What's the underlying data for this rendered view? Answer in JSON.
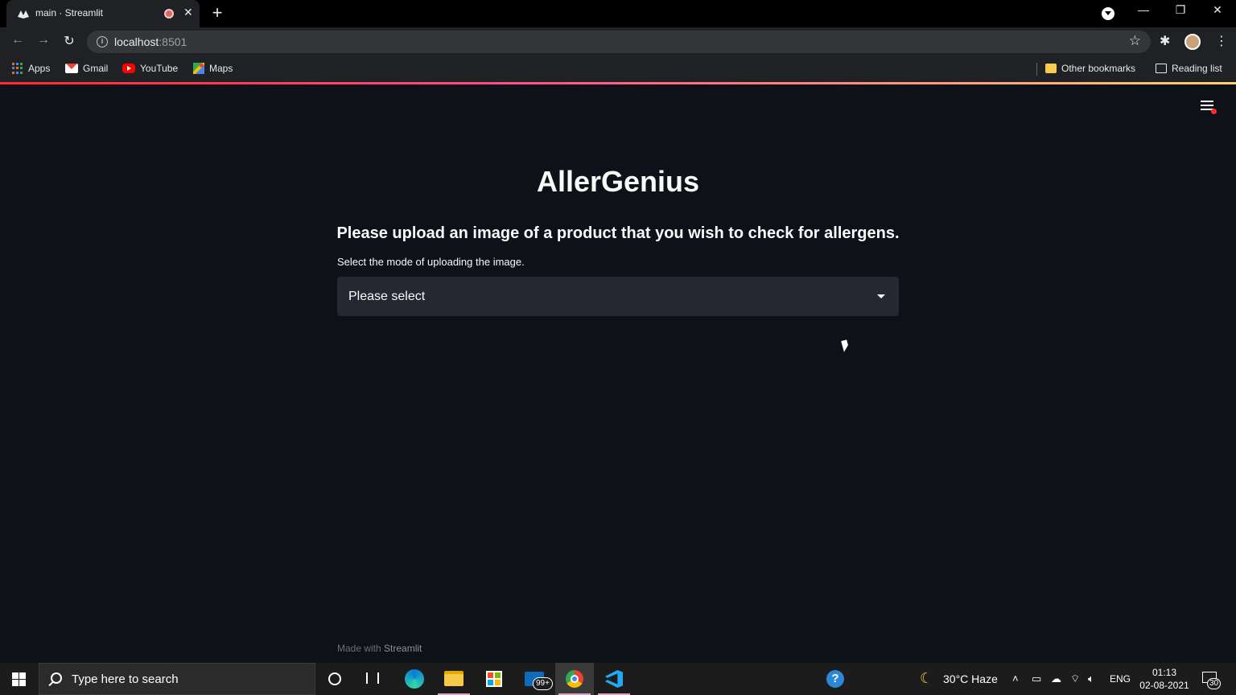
{
  "browser": {
    "tab_title": "main · Streamlit",
    "tab_close": "✕",
    "new_tab": "+",
    "url_host": "localhost",
    "url_port": ":8501",
    "window_controls": {
      "minimize": "—",
      "restore": "❐",
      "close": "✕"
    },
    "bookmarks": [
      {
        "label": "Apps",
        "icon": "apps-grid-icon"
      },
      {
        "label": "Gmail",
        "icon": "gmail-icon"
      },
      {
        "label": "YouTube",
        "icon": "youtube-icon"
      },
      {
        "label": "Maps",
        "icon": "maps-icon"
      }
    ],
    "other_bookmarks": "Other bookmarks",
    "reading_list": "Reading list"
  },
  "app": {
    "title": "AllerGenius",
    "subtitle": "Please upload an image of a product that you wish to check for allergens.",
    "select_label": "Select the mode of uploading the image.",
    "select_value": "Please select",
    "footer_prefix": "Made with ",
    "footer_brand": "Streamlit"
  },
  "taskbar": {
    "search_placeholder": "Type here to search",
    "mail_badge": "99+",
    "weather": "30°C  Haze",
    "language": "ENG",
    "time": "01:13",
    "date": "02-08-2021",
    "notifications": "30"
  },
  "colors": {
    "app_bg": "#0e1117",
    "select_bg": "#262730",
    "accent_start": "#ff2b2b",
    "accent_end": "#ffd16a"
  }
}
